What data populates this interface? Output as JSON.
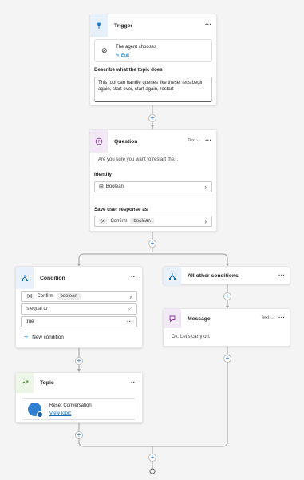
{
  "trigger": {
    "title": "Trigger",
    "agent_chooses": "The agent chooses",
    "edit_label": "Edit",
    "describe_label": "Describe what the topic does",
    "description": "This tool can handle queries like these: let's begin again, start over, start again, restart"
  },
  "question": {
    "title": "Question",
    "badge": "Text",
    "prompt": "Are you sure you want to restart the...",
    "identify_label": "Identify",
    "identify_value": "Boolean",
    "save_label": "Save user response as",
    "var_name": "Confirm",
    "var_type": "boolean"
  },
  "condition": {
    "title": "Condition",
    "var_name": "Confirm",
    "var_type": "boolean",
    "operator": "is equal to",
    "value": "true",
    "new_condition_label": "New condition"
  },
  "other": {
    "title": "All other conditions"
  },
  "message": {
    "title": "Message",
    "badge": "Text",
    "text": "Ok. Let's carry on."
  },
  "topic": {
    "title": "Topic",
    "name": "Reset Conversation",
    "link": "View topic"
  },
  "colors": {
    "trigger_accent": "#e6f0fb",
    "question_accent": "#f3e8f5",
    "condition_accent": "#e8f1fb",
    "topic_accent": "#ecf6e6",
    "link": "#0f6cbd"
  }
}
